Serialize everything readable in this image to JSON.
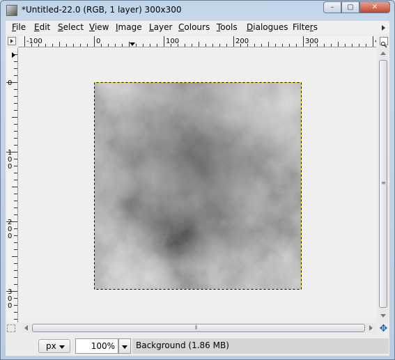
{
  "window": {
    "title": "*Untitled-22.0 (RGB, 1 layer) 300x300",
    "buttons": {
      "minimize": "–",
      "maximize": "▢",
      "close": "✕"
    }
  },
  "menubar": {
    "items": [
      {
        "label": "File",
        "u": "F",
        "rest": "ile"
      },
      {
        "label": "Edit",
        "u": "E",
        "rest": "dit"
      },
      {
        "label": "Select",
        "u": "S",
        "rest": "elect"
      },
      {
        "label": "View",
        "u": "V",
        "rest": "iew"
      },
      {
        "label": "Image",
        "u": "I",
        "rest": "mage"
      },
      {
        "label": "Layer",
        "u": "L",
        "rest": "ayer"
      },
      {
        "label": "Colours",
        "u": "C",
        "rest": "olours"
      },
      {
        "label": "Tools",
        "u": "T",
        "rest": "ools"
      },
      {
        "label": "Dialogues",
        "u": "D",
        "rest": "ialogues"
      },
      {
        "label": "Filters",
        "u": "r",
        "rest": "Filte|s"
      }
    ]
  },
  "rulers": {
    "horizontal_labels": [
      "-100",
      "0",
      "100",
      "200",
      "300",
      "4"
    ],
    "vertical_labels": [
      "0",
      "100",
      "200",
      "300"
    ]
  },
  "status": {
    "unit": "px",
    "zoom": "100%",
    "message": "Background (1.86 MB)"
  },
  "colors": {
    "canvas_bg": "#efefef",
    "selection_dash": "#f2e300",
    "nav_icon": "#1c5da8"
  },
  "icons": {
    "navigate": "navigate-icon",
    "quick_mask": "quick-mask-icon",
    "zoom_toggle": "zoom-toggle-icon",
    "menu_toggle": "menu-toggle-icon"
  }
}
